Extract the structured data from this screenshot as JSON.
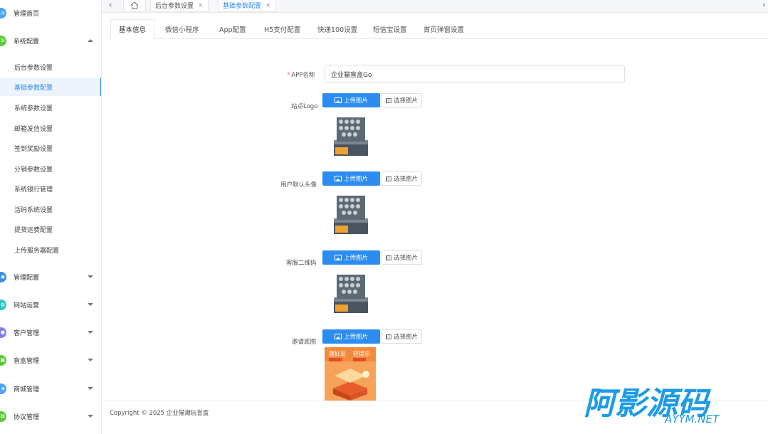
{
  "sidebar": {
    "home_label": "管理首页",
    "system_label": "系统配置",
    "sub_items": [
      "后台参数设置",
      "基础参数配置",
      "系统参数设置",
      "邮箱发信设置",
      "签到奖励设置",
      "分销参数设置",
      "系统银行管理",
      "活码系统设置",
      "提货运费配置",
      "上传服务器配置"
    ],
    "groups": [
      "管理配置",
      "网站运营",
      "客户管理",
      "盲盒管理",
      "商城管理",
      "协议管理"
    ]
  },
  "top_tabs": {
    "tab1": "后台参数设置",
    "tab2": "基础参数配置",
    "close": "×",
    "left_arrow": "‹",
    "right_arrow": "›"
  },
  "form_tabs": [
    "基本信息",
    "微信小程序",
    "App配置",
    "H5支付配置",
    "快递100设置",
    "短信宝设置",
    "首页弹窗设置"
  ],
  "form": {
    "app_name_label": "APP名称",
    "app_name_required": "*",
    "app_name_value": "企业猫盲盒Go",
    "logo_label": "站点Logo",
    "avatar_label": "用户默认头像",
    "qrcode_label": "客服二维码",
    "poster_label": "邀请底图",
    "upload_label": "上传图片",
    "select_label": "选择图片"
  },
  "poster": {
    "text_left": "邀好友",
    "text_right": "轻提示"
  },
  "footer": {
    "copyright": "Copyright © 2025 企业猫潮玩盲盒"
  },
  "watermark": {
    "title": "阿影源码",
    "url": "AYYM.NET"
  },
  "colors": {
    "accent": "#2d8cf0",
    "home_icon": "#4aa3f5",
    "system_icon": "#5cc93a",
    "manage_icon": "#3a8ee6",
    "site_icon": "#2ac6c6",
    "customer_icon": "#7e7ef0",
    "box_icon": "#5cc93a",
    "mall_icon": "#4aa3f5",
    "protocol_icon": "#5cc93a",
    "watermark": "#1e9be8"
  }
}
